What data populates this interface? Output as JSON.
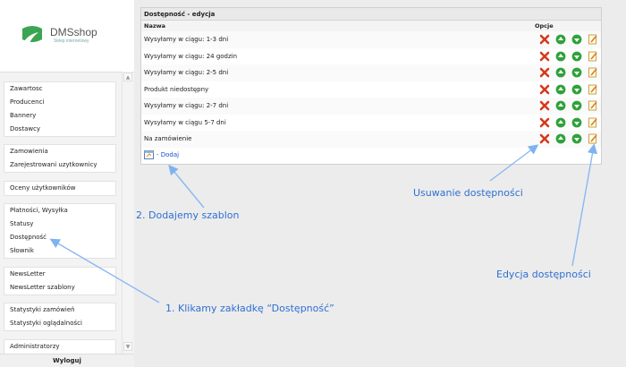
{
  "logo": {
    "name": "DMSshop",
    "subtitle": "Sklep internetowy"
  },
  "sidebar": {
    "groups": [
      {
        "items": [
          "Zawartosc",
          "Producenci",
          "Bannery",
          "Dostawcy"
        ]
      },
      {
        "items": [
          "Zamowienia",
          "Zarejestrowani uzytkownicy"
        ]
      },
      {
        "items": [
          "Oceny użytkowników"
        ]
      },
      {
        "items": [
          "Płatności, Wysyłka",
          "Statusy",
          "Dostępność",
          "Słownik"
        ]
      },
      {
        "items": [
          "NewsLetter",
          "NewsLetter szablony"
        ]
      },
      {
        "items": [
          "Statystyki zamówień",
          "Statystyki oglądalności"
        ]
      },
      {
        "items": [
          "Administratorzy"
        ]
      }
    ],
    "logout": "Wyloguj"
  },
  "panel": {
    "title": "Dostępność - edycja",
    "col_name": "Nazwa",
    "col_options": "Opcje",
    "rows": [
      "Wysyłamy w ciągu: 1-3 dni",
      "Wysyłamy w ciągu: 24 godzin",
      "Wysyłamy w ciągu: 2-5 dni",
      "Produkt niedostępny",
      "Wysyłamy w ciągu: 2-7 dni",
      "Wysyłamy w ciągu 5-7 dni",
      "Na zamówienie"
    ],
    "add_label": "- Dodaj"
  },
  "annotations": {
    "step1": "1. Klikamy zakładkę “Dostępność”",
    "step2": "2. Dodajemy szablon",
    "delete": "Usuwanie dostępności",
    "edit": "Edycja dostępności"
  },
  "colors": {
    "annotation": "#2f6fd4",
    "delete": "#d33a1c",
    "move": "#2fa23a",
    "link": "#1a4fd0"
  }
}
